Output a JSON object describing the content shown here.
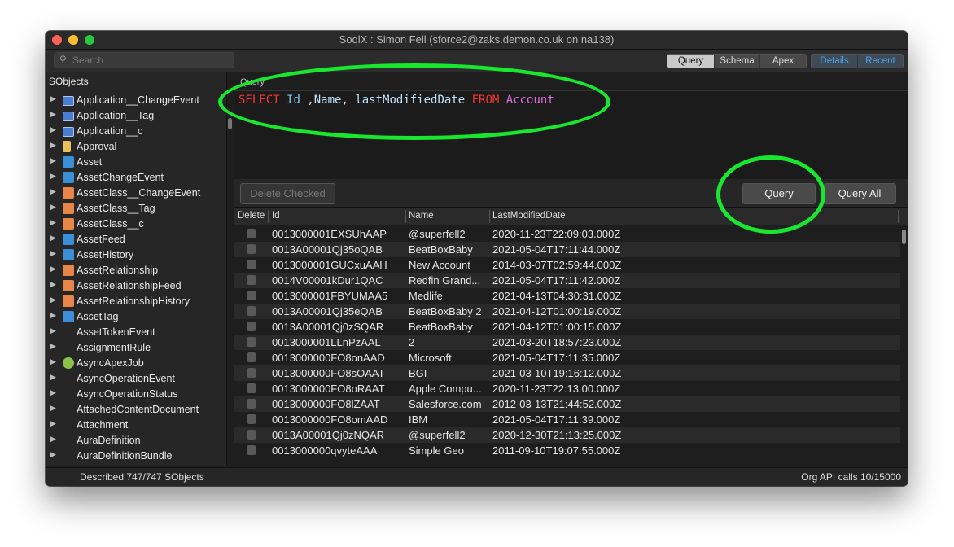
{
  "window": {
    "title": "SoqlX : Simon Fell (sforce2@zaks.demon.co.uk on na138)"
  },
  "search": {
    "placeholder": "Search"
  },
  "view_tabs": [
    {
      "label": "Query",
      "active": true
    },
    {
      "label": "Schema",
      "active": false
    },
    {
      "label": "Apex",
      "active": false
    }
  ],
  "side_tabs": [
    {
      "label": "Details"
    },
    {
      "label": "Recent"
    }
  ],
  "sidebar": {
    "header": "SObjects",
    "items": [
      {
        "label": "Application__ChangeEvent",
        "icon": "monitor-icon"
      },
      {
        "label": "Application__Tag",
        "icon": "monitor-icon"
      },
      {
        "label": "Application__c",
        "icon": "monitor-icon"
      },
      {
        "label": "Approval",
        "icon": "book-icon"
      },
      {
        "label": "Asset",
        "icon": "asset-icon"
      },
      {
        "label": "AssetChangeEvent",
        "icon": "asset-icon"
      },
      {
        "label": "AssetClass__ChangeEvent",
        "icon": "blocks-icon"
      },
      {
        "label": "AssetClass__Tag",
        "icon": "blocks-icon"
      },
      {
        "label": "AssetClass__c",
        "icon": "blocks-icon"
      },
      {
        "label": "AssetFeed",
        "icon": "asset-icon"
      },
      {
        "label": "AssetHistory",
        "icon": "asset-icon"
      },
      {
        "label": "AssetRelationship",
        "icon": "relationship-icon"
      },
      {
        "label": "AssetRelationshipFeed",
        "icon": "relationship-icon"
      },
      {
        "label": "AssetRelationshipHistory",
        "icon": "relationship-icon"
      },
      {
        "label": "AssetTag",
        "icon": "asset-icon"
      },
      {
        "label": "AssetTokenEvent",
        "icon": ""
      },
      {
        "label": "AssignmentRule",
        "icon": ""
      },
      {
        "label": "AsyncApexJob",
        "icon": "multicolor-icon"
      },
      {
        "label": "AsyncOperationEvent",
        "icon": ""
      },
      {
        "label": "AsyncOperationStatus",
        "icon": ""
      },
      {
        "label": "AttachedContentDocument",
        "icon": ""
      },
      {
        "label": "Attachment",
        "icon": ""
      },
      {
        "label": "AuraDefinition",
        "icon": ""
      },
      {
        "label": "AuraDefinitionBundle",
        "icon": ""
      }
    ]
  },
  "query": {
    "label": "Query",
    "tokens": [
      {
        "text": "SELECT",
        "kind": "kw"
      },
      {
        "text": " ",
        "kind": "pl"
      },
      {
        "text": "Id",
        "kind": "id"
      },
      {
        "text": " ,",
        "kind": "pl"
      },
      {
        "text": "Name",
        "kind": "fld"
      },
      {
        "text": ", ",
        "kind": "pl"
      },
      {
        "text": "lastModifiedDate",
        "kind": "fld"
      },
      {
        "text": " ",
        "kind": "pl"
      },
      {
        "text": "FROM",
        "kind": "kw"
      },
      {
        "text": " ",
        "kind": "pl"
      },
      {
        "text": "Account",
        "kind": "tbl"
      }
    ]
  },
  "actions": {
    "delete_checked": "Delete Checked",
    "query": "Query",
    "query_all": "Query All"
  },
  "results": {
    "columns": [
      "Delete",
      "Id",
      "Name",
      "LastModifiedDate"
    ],
    "rows": [
      [
        "0013000001EXSUhAAP",
        "@superfell2",
        "2020-11-23T22:09:03.000Z"
      ],
      [
        "0013A00001Qj35oQAB",
        "BeatBoxBaby",
        "2021-05-04T17:11:44.000Z"
      ],
      [
        "0013000001GUCxuAAH",
        "New Account",
        "2014-03-07T02:59:44.000Z"
      ],
      [
        "0014V00001kDur1QAC",
        "Redfin Grand...",
        "2021-05-04T17:11:42.000Z"
      ],
      [
        "0013000001FBYUMAA5",
        "Medlife",
        "2021-04-13T04:30:31.000Z"
      ],
      [
        "0013A00001Qj35eQAB",
        "BeatBoxBaby 2",
        "2021-04-12T01:00:19.000Z"
      ],
      [
        "0013A00001Qj0zSQAR",
        "BeatBoxBaby",
        "2021-04-12T01:00:15.000Z"
      ],
      [
        "0013000001LLnPzAAL",
        "2",
        "2021-03-20T18:57:23.000Z"
      ],
      [
        "0013000000FO8onAAD",
        "Microsoft",
        "2021-05-04T17:11:35.000Z"
      ],
      [
        "0013000000FO8sOAAT",
        "BGI",
        "2021-03-10T19:16:12.000Z"
      ],
      [
        "0013000000FO8oRAAT",
        "Apple Compu...",
        "2020-11-23T22:13:00.000Z"
      ],
      [
        "0013000000FO8lZAAT",
        "Salesforce.com",
        "2012-03-13T21:44:52.000Z"
      ],
      [
        "0013000000FO8omAAD",
        "IBM",
        "2021-05-04T17:11:39.000Z"
      ],
      [
        "0013A00001Qj0zNQAR",
        "@superfell2",
        "2020-12-30T21:13:25.000Z"
      ],
      [
        "0013000000qvyteAAA",
        "Simple Geo",
        "2011-09-10T19:07:55.000Z"
      ]
    ]
  },
  "status": {
    "left": "Described 747/747 SObjects",
    "right": "Org API calls 10/15000"
  },
  "colors": {
    "annotation": "#19e62e",
    "keyword": "#f2382f",
    "table": "#e06ddc",
    "field": "#bfe3fa"
  }
}
